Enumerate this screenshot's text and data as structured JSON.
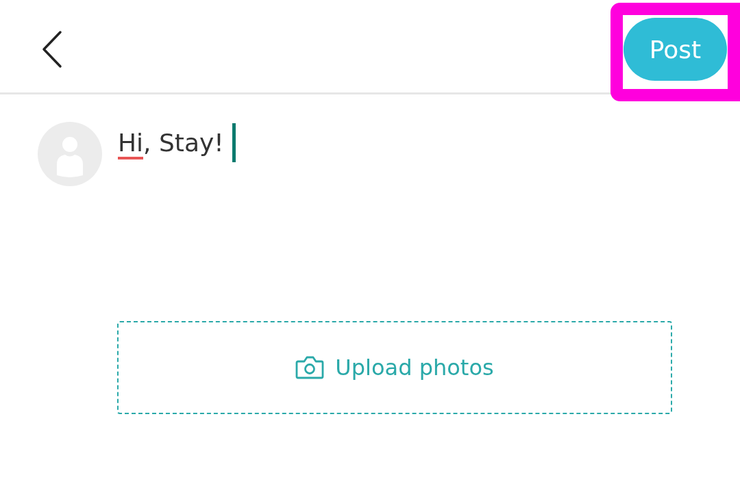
{
  "header": {
    "post_button": {
      "label": "Post",
      "highlighted": true
    }
  },
  "composer": {
    "focused": true,
    "segments": [
      {
        "text": "Hi",
        "misspelled": true
      },
      {
        "text": ", Stay!",
        "misspelled": false
      }
    ]
  },
  "upload": {
    "label": "Upload photos"
  }
}
